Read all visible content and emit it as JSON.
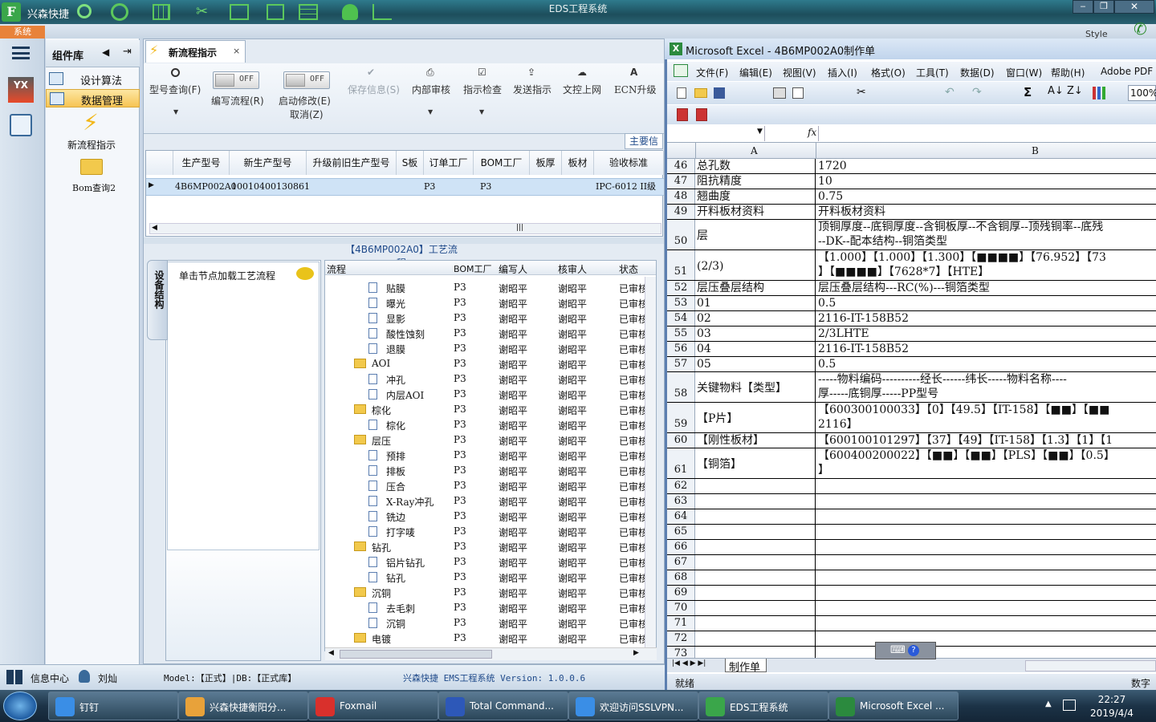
{
  "titlebar": {
    "app_name": "兴森快捷",
    "window_title": "EDS工程系统",
    "style_label": "Style"
  },
  "system_tab": "系统",
  "component_panel": {
    "title": "组件库",
    "items": [
      {
        "label": "设计算法"
      },
      {
        "label": "数据管理"
      }
    ],
    "shortcuts": [
      {
        "label": "新流程指示"
      },
      {
        "label": "Bom查询2"
      }
    ]
  },
  "doc_tab": {
    "label": "新流程指示"
  },
  "toolbar": {
    "model_query": "型号查询(F)",
    "write_flow": "编写流程(R)",
    "start_modify": "启动修改(E)",
    "cancel": "取消(Z)",
    "toggle_off": "OFF",
    "save_info": "保存信息(S)",
    "internal_review": "内部审核",
    "instruction_check": "指示检查",
    "send_instruction": "发送指示",
    "upload": "文控上网",
    "ecn_upgrade": "ECN升级",
    "main_info": "主要信"
  },
  "grid": {
    "headers": [
      "生产型号",
      "新生产型号",
      "升级前旧生产型号",
      "S板",
      "订单工厂",
      "BOM工厂",
      "板厚",
      "板材",
      "验收标准"
    ],
    "row": [
      "4B6MP002A0",
      "10010400130861",
      "",
      "",
      "P3",
      "P3",
      "",
      "",
      "IPC-6012 II级"
    ]
  },
  "lower": {
    "process_title": "【4B6MP002A0】工艺流程",
    "side_tab": "设备结构",
    "load_hint": "单击节点加载工艺流程",
    "tree_headers": [
      "流程",
      "BOM工厂",
      "编写人",
      "核审人",
      "状态"
    ],
    "tree_rows": [
      {
        "name": "贴膜",
        "type": "file",
        "factory": "P3",
        "writer": "谢昭平",
        "reviewer": "谢昭平",
        "status": "已审核"
      },
      {
        "name": "曝光",
        "type": "file",
        "factory": "P3",
        "writer": "谢昭平",
        "reviewer": "谢昭平",
        "status": "已审核"
      },
      {
        "name": "显影",
        "type": "file",
        "factory": "P3",
        "writer": "谢昭平",
        "reviewer": "谢昭平",
        "status": "已审核"
      },
      {
        "name": "酸性蚀刻",
        "type": "file",
        "factory": "P3",
        "writer": "谢昭平",
        "reviewer": "谢昭平",
        "status": "已审核"
      },
      {
        "name": "退膜",
        "type": "file",
        "factory": "P3",
        "writer": "谢昭平",
        "reviewer": "谢昭平",
        "status": "已审核"
      },
      {
        "name": "AOI",
        "type": "folder",
        "factory": "P3",
        "writer": "谢昭平",
        "reviewer": "谢昭平",
        "status": "已审核"
      },
      {
        "name": "冲孔",
        "type": "file",
        "factory": "P3",
        "writer": "谢昭平",
        "reviewer": "谢昭平",
        "status": "已审核"
      },
      {
        "name": "内层AOI",
        "type": "file",
        "factory": "P3",
        "writer": "谢昭平",
        "reviewer": "谢昭平",
        "status": "已审核"
      },
      {
        "name": "棕化",
        "type": "folder",
        "factory": "P3",
        "writer": "谢昭平",
        "reviewer": "谢昭平",
        "status": "已审核"
      },
      {
        "name": "棕化",
        "type": "file",
        "factory": "P3",
        "writer": "谢昭平",
        "reviewer": "谢昭平",
        "status": "已审核"
      },
      {
        "name": "层压",
        "type": "folder",
        "factory": "P3",
        "writer": "谢昭平",
        "reviewer": "谢昭平",
        "status": "已审核"
      },
      {
        "name": "预排",
        "type": "file",
        "factory": "P3",
        "writer": "谢昭平",
        "reviewer": "谢昭平",
        "status": "已审核"
      },
      {
        "name": "排板",
        "type": "file",
        "factory": "P3",
        "writer": "谢昭平",
        "reviewer": "谢昭平",
        "status": "已审核"
      },
      {
        "name": "压合",
        "type": "file",
        "factory": "P3",
        "writer": "谢昭平",
        "reviewer": "谢昭平",
        "status": "已审核"
      },
      {
        "name": "X-Ray冲孔",
        "type": "file",
        "factory": "P3",
        "writer": "谢昭平",
        "reviewer": "谢昭平",
        "status": "已审核"
      },
      {
        "name": "铣边",
        "type": "file",
        "factory": "P3",
        "writer": "谢昭平",
        "reviewer": "谢昭平",
        "status": "已审核"
      },
      {
        "name": "打字唛",
        "type": "file",
        "factory": "P3",
        "writer": "谢昭平",
        "reviewer": "谢昭平",
        "status": "已审核"
      },
      {
        "name": "钻孔",
        "type": "folder",
        "factory": "P3",
        "writer": "谢昭平",
        "reviewer": "谢昭平",
        "status": "已审核"
      },
      {
        "name": "铝片钻孔",
        "type": "file",
        "factory": "P3",
        "writer": "谢昭平",
        "reviewer": "谢昭平",
        "status": "已审核"
      },
      {
        "name": "钻孔",
        "type": "file",
        "factory": "P3",
        "writer": "谢昭平",
        "reviewer": "谢昭平",
        "status": "已审核"
      },
      {
        "name": "沉铜",
        "type": "folder",
        "factory": "P3",
        "writer": "谢昭平",
        "reviewer": "谢昭平",
        "status": "已审核"
      },
      {
        "name": "去毛刺",
        "type": "file",
        "factory": "P3",
        "writer": "谢昭平",
        "reviewer": "谢昭平",
        "status": "已审核"
      },
      {
        "name": "沉铜",
        "type": "file",
        "factory": "P3",
        "writer": "谢昭平",
        "reviewer": "谢昭平",
        "status": "已审核"
      },
      {
        "name": "电镀",
        "type": "folder",
        "factory": "P3",
        "writer": "谢昭平",
        "reviewer": "谢昭平",
        "status": "已审核"
      }
    ]
  },
  "statusbar": {
    "info_center": "信息中心",
    "user": "刘灿",
    "model": "Model:【正式】|DB:【正式库】",
    "version": "兴森快捷 EMS工程系统 Version: 1.0.0.6"
  },
  "excel": {
    "title": "Microsoft Excel - 4B6MP002A0制作单",
    "menu": [
      "文件(F)",
      "编辑(E)",
      "视图(V)",
      "插入(I)",
      "格式(O)",
      "工具(T)",
      "数据(D)",
      "窗口(W)",
      "帮助(H)",
      "Adobe PDF"
    ],
    "zoom": "100%",
    "fx": "fx",
    "col_a": "A",
    "col_b": "B",
    "rows": [
      {
        "n": "46",
        "a": "总孔数",
        "b": "1720"
      },
      {
        "n": "47",
        "a": "阻抗精度",
        "b": "10"
      },
      {
        "n": "48",
        "a": "翘曲度",
        "b": "0.75"
      },
      {
        "n": "49",
        "a": "开料板材资料",
        "b": "开料板材资料"
      },
      {
        "n": "50",
        "a": "层",
        "b": "顶铜厚度--底铜厚度--含铜板厚--不含铜厚--顶残铜率--底残",
        "b2": "--DK--配本结构--铜箔类型"
      },
      {
        "n": "51",
        "a": "(2/3)",
        "b": "【1.000】【1.000】【1.300】【■■■■】【76.952】【73",
        "b2": "】【■■■■】【7628*7】【HTE】"
      },
      {
        "n": "52",
        "a": "层压叠层结构",
        "b": "层压叠层结构---RC(%)---铜箔类型"
      },
      {
        "n": "53",
        "a": "01",
        "b": "0.5"
      },
      {
        "n": "54",
        "a": "02",
        "b": "2116-IT-158B52"
      },
      {
        "n": "55",
        "a": "03",
        "b": "2/3LHTE"
      },
      {
        "n": "56",
        "a": "04",
        "b": "2116-IT-158B52"
      },
      {
        "n": "57",
        "a": "05",
        "b": "0.5"
      },
      {
        "n": "58",
        "a": "关键物料【类型】",
        "b": "-----物料编码----------经长------纬长-----物料名称----",
        "b2": "厚-----底铜厚-----PP型号"
      },
      {
        "n": "59",
        "a": "【P片】",
        "b": "【600300100033】【0】【49.5】【IT-158】【■■】【■■",
        "b2": "2116】"
      },
      {
        "n": "60",
        "a": "【刚性板材】",
        "b": "【600100101297】【37】【49】【IT-158】【1.3】【1】【1"
      },
      {
        "n": "61",
        "a": "【铜箔】",
        "b": "【600400200022】【■■】【■■】【PLS】【■■】【0.5】",
        "b2": "】"
      },
      {
        "n": "62",
        "a": "",
        "b": ""
      },
      {
        "n": "63",
        "a": "",
        "b": ""
      },
      {
        "n": "64",
        "a": "",
        "b": ""
      },
      {
        "n": "65",
        "a": "",
        "b": ""
      },
      {
        "n": "66",
        "a": "",
        "b": ""
      },
      {
        "n": "67",
        "a": "",
        "b": ""
      },
      {
        "n": "68",
        "a": "",
        "b": ""
      },
      {
        "n": "69",
        "a": "",
        "b": ""
      },
      {
        "n": "70",
        "a": "",
        "b": ""
      },
      {
        "n": "71",
        "a": "",
        "b": ""
      },
      {
        "n": "72",
        "a": "",
        "b": ""
      },
      {
        "n": "73",
        "a": "",
        "b": ""
      }
    ],
    "sheet_tab": "制作单",
    "status_ready": "就绪",
    "status_num": "数字"
  },
  "taskbar": {
    "items": [
      {
        "label": "钉钉",
        "color": "#3a8ee6"
      },
      {
        "label": "兴森快捷衡阳分...",
        "color": "#e8a23a"
      },
      {
        "label": "Foxmail",
        "color": "#d9302c"
      },
      {
        "label": "Total Command...",
        "color": "#2d58b8"
      },
      {
        "label": "欢迎访问SSLVPN...",
        "color": "#3a8ee6"
      },
      {
        "label": "EDS工程系统",
        "color": "#3aa64a"
      },
      {
        "label": "Microsoft Excel ...",
        "color": "#2b8a3e"
      }
    ],
    "time": "22:27",
    "date": "2019/4/4"
  }
}
